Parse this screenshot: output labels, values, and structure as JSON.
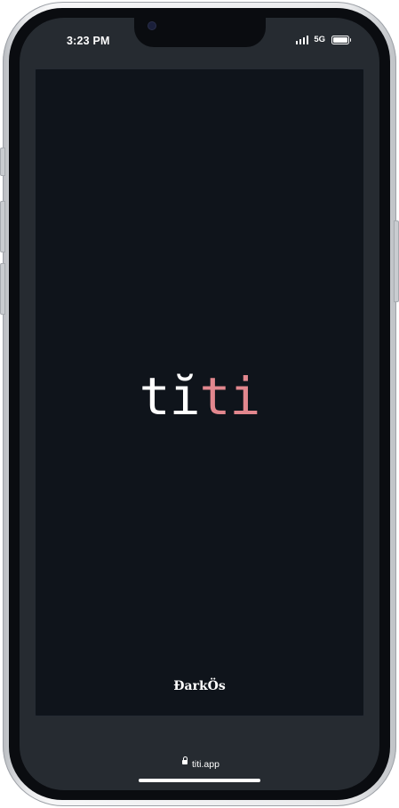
{
  "status_bar": {
    "time": "3:23 PM",
    "network": "5G",
    "icons": [
      "signal-icon",
      "battery-icon"
    ]
  },
  "app": {
    "logo_part_1": "tĭ",
    "logo_part_2": "ti",
    "footer_brand": "ĐarkÖs"
  },
  "browser": {
    "url": "titi.app",
    "icons": [
      "lock-icon"
    ]
  },
  "colors": {
    "background": "#0f141b",
    "logo_white": "#ffffff",
    "logo_accent": "#e2878e"
  }
}
